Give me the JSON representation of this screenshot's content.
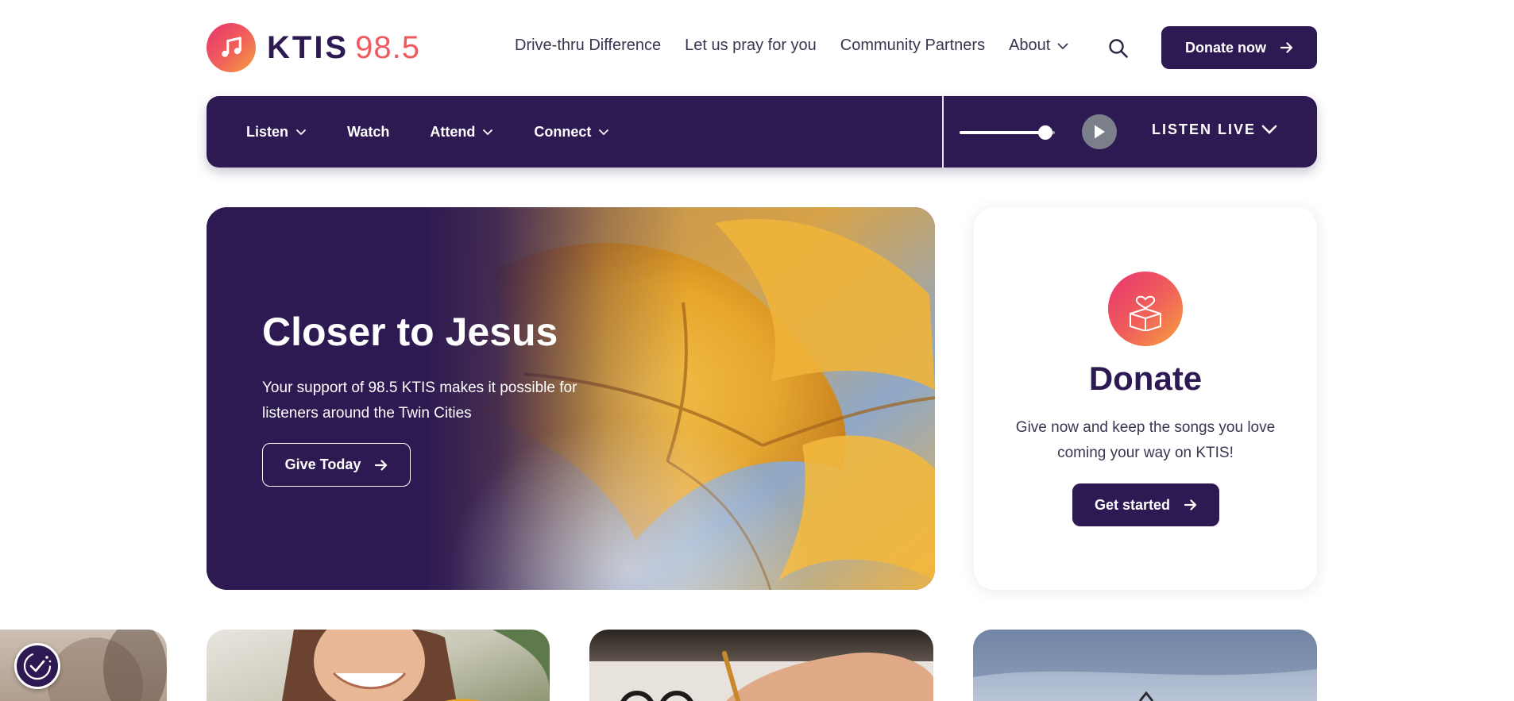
{
  "logo": {
    "brand": "KTIS",
    "frequency": "98.5",
    "icon": "music-note-icon"
  },
  "topnav": {
    "items": [
      "Drive-thru Difference",
      "Let us pray for you",
      "Community Partners"
    ],
    "about": "About"
  },
  "header": {
    "donate_label": "Donate now"
  },
  "mainnav": {
    "listen": "Listen",
    "watch": "Watch",
    "attend": "Attend",
    "connect": "Connect"
  },
  "player": {
    "listen_live": "LISTEN LIVE",
    "volume_percent": 90
  },
  "hero": {
    "title": "Closer to Jesus",
    "text": "Your support of 98.5 KTIS makes it possible for listeners around the Twin Cities",
    "button": "Give Today"
  },
  "donate_card": {
    "heading": "Donate",
    "text": "Give now and keep the songs you love coming your way on KTIS!",
    "button": "Get started",
    "icon": "donation-box-heart-icon"
  },
  "colors": {
    "brand_purple": "#2e1a52",
    "gradient_start": "#e8336e",
    "gradient_end": "#f6a23b"
  }
}
